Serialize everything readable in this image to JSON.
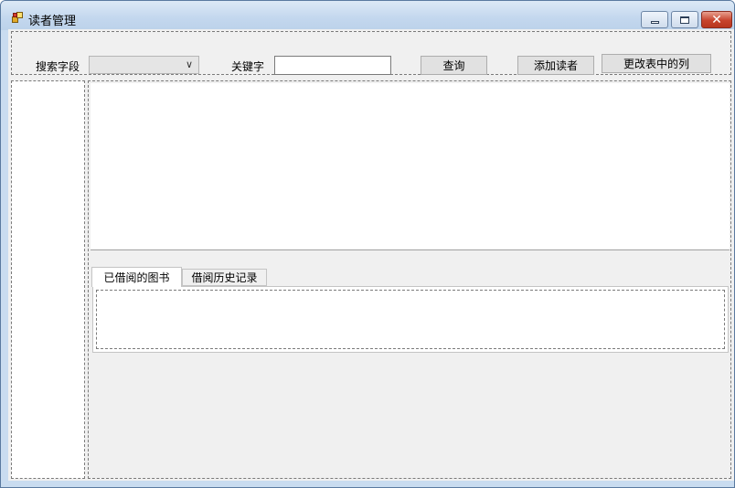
{
  "window": {
    "title": "读者管理"
  },
  "toolbar": {
    "search_field_label": "搜索字段",
    "search_field_value": "",
    "keyword_label": "关键字",
    "keyword_value": "",
    "query_button": "查询",
    "add_reader_button": "添加读者",
    "change_columns_button": "更改表中的列"
  },
  "tabs": [
    {
      "label": "已借阅的图书",
      "selected": true
    },
    {
      "label": "借阅历史记录",
      "selected": false
    }
  ],
  "colors": {
    "client_background": "#f0f0f0",
    "close_button": "#c7442d",
    "title_bar": "#c3d7ee"
  },
  "icons": {
    "app": "app-form-icon",
    "minimize": "minimize-icon",
    "maximize": "maximize-icon",
    "close": "close-icon",
    "dropdown": "chevron-down-icon"
  }
}
